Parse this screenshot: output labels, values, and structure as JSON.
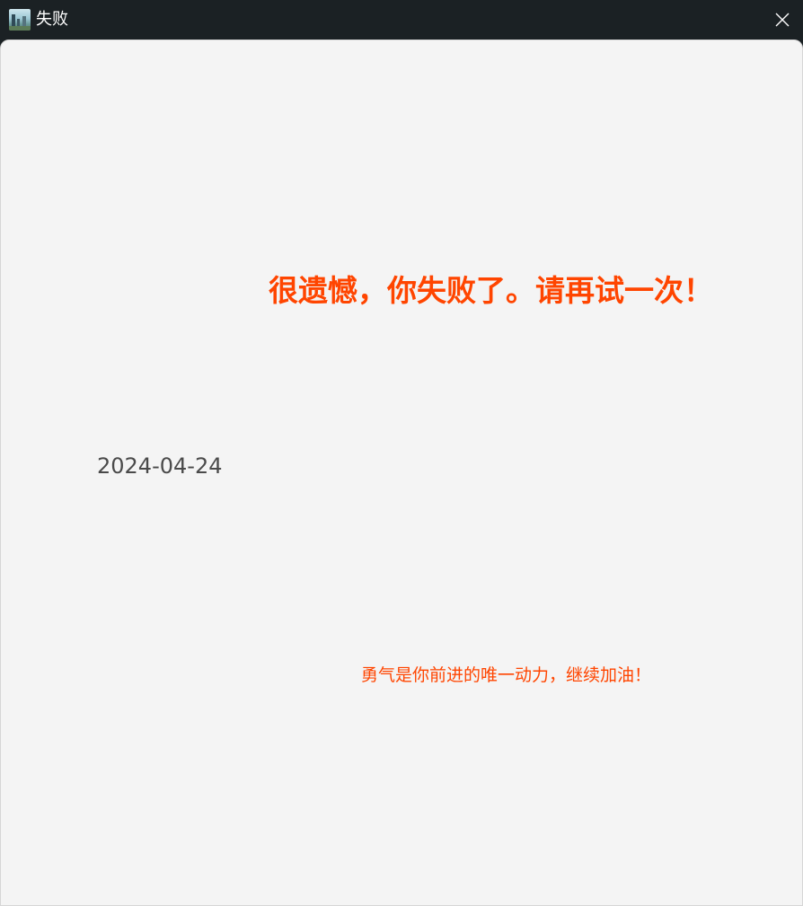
{
  "window": {
    "title": "失败",
    "app_icon": "landscape-photo-icon",
    "close_icon": "close-icon"
  },
  "message": {
    "headline": "很遗憾，你失败了。请再试一次！",
    "date": "2024-04-24",
    "encouragement": "勇气是你前进的唯一动力，继续加油！"
  },
  "colors": {
    "titlebar_bg": "#1b2124",
    "content_bg": "#f4f4f4",
    "accent": "#ff4500",
    "date_text": "#4a4a4a"
  }
}
